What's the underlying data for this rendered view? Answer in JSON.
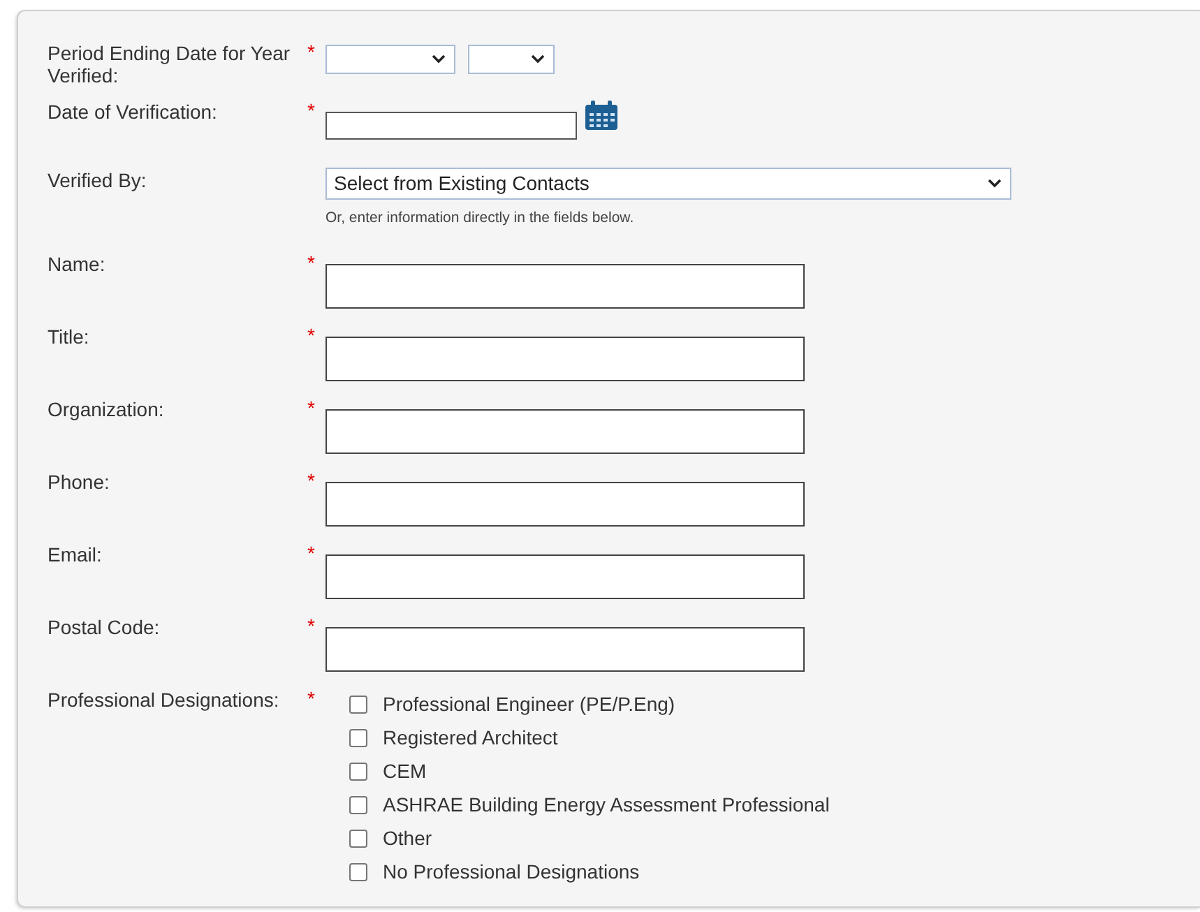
{
  "period": {
    "label": "Period Ending Date for Year Verified:",
    "required_mark": "*"
  },
  "date_of_verification": {
    "label": "Date of Verification:",
    "required_mark": "*"
  },
  "verified_by": {
    "label": "Verified By:",
    "value": "Select from Existing Contacts",
    "hint": "Or, enter information directly in the fields below."
  },
  "fields": [
    {
      "label": "Name:",
      "required_mark": "*"
    },
    {
      "label": "Title:",
      "required_mark": "*"
    },
    {
      "label": "Organization:",
      "required_mark": "*"
    },
    {
      "label": "Phone:",
      "required_mark": "*"
    },
    {
      "label": "Email:",
      "required_mark": "*"
    },
    {
      "label": "Postal Code:",
      "required_mark": "*"
    }
  ],
  "designations": {
    "label": "Professional Designations:",
    "required_mark": "*",
    "options": [
      {
        "label": "Professional Engineer (PE/P.Eng)",
        "checked": false
      },
      {
        "label": "Registered Architect",
        "checked": false
      },
      {
        "label": "CEM",
        "checked": false
      },
      {
        "label": "ASHRAE Building Energy Assessment Professional",
        "checked": false
      },
      {
        "label": "Other",
        "checked": false
      },
      {
        "label": "No Professional Designations",
        "checked": false
      }
    ]
  }
}
